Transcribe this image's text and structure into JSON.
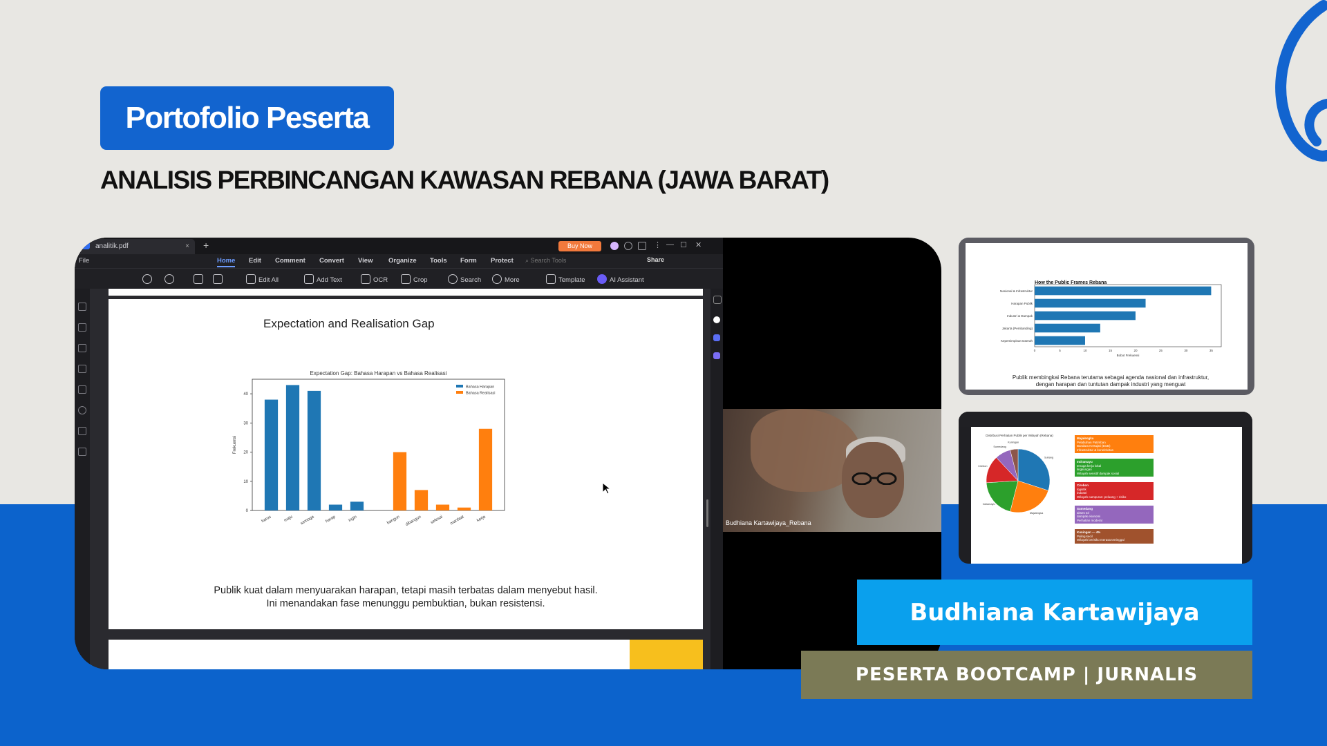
{
  "header": {
    "badge": "Portofolio Peserta",
    "subtitle": "ANALISIS PERBINCANGAN KAWASAN REBANA (JAWA BARAT)"
  },
  "app": {
    "tab_label": "analitik.pdf",
    "buy_now": "Buy Now",
    "menu": {
      "file": "File",
      "items": [
        "Home",
        "Edit",
        "Comment",
        "Convert",
        "View",
        "Organize",
        "Tools",
        "Form",
        "Protect"
      ],
      "active": "Home",
      "search_placeholder": "Search Tools",
      "share": "Share"
    },
    "toolbar": {
      "edit_all": "Edit All",
      "add_text": "Add Text",
      "ocr": "OCR",
      "crop": "Crop",
      "search": "Search",
      "more": "More",
      "template": "Template",
      "ai_assistant": "AI Assistant"
    },
    "page": {
      "title": "Expectation and Realisation Gap",
      "caption": "Publik kuat dalam menyuarakan harapan, tetapi masih terbatas dalam menyebut hasil. Ini menandakan fase menunggu pembuktian, bukan resistensi."
    }
  },
  "webcam": {
    "name": "Budhiana Kartawijaya_Rebana"
  },
  "chart_data": [
    {
      "type": "bar",
      "title": "Expectation Gap: Bahasa Harapan vs Bahasa Realisasi",
      "xlabel": "",
      "ylabel": "Frekuensi",
      "ylim": [
        0,
        45
      ],
      "yticks": [
        0,
        10,
        20,
        30,
        40
      ],
      "legend": "top-right",
      "categories": [
        "harus",
        "maju",
        "semoga",
        "harap",
        "ingin",
        "",
        "bangun",
        "dibangun",
        "selesai",
        "manfaat",
        "kerja"
      ],
      "series": [
        {
          "name": "Bahasa Harapan",
          "color": "#1f77b4",
          "values": [
            38,
            43,
            41,
            2,
            3,
            null,
            null,
            null,
            null,
            null,
            null
          ]
        },
        {
          "name": "Bahasa Realisasi",
          "color": "#ff7f0e",
          "values": [
            null,
            null,
            null,
            null,
            null,
            null,
            20,
            7,
            2,
            1,
            28
          ]
        }
      ]
    },
    {
      "type": "bar",
      "orientation": "horizontal",
      "title": "How the Public Frames Rebana",
      "xlabel": "Bobot Frekuensi",
      "ylabel": "",
      "xlim": [
        0,
        37
      ],
      "xticks": [
        0,
        5,
        10,
        15,
        20,
        25,
        30,
        35
      ],
      "color": "#1f77b4",
      "categories": [
        "Nasional & Infrastruktur",
        "Harapan Publik",
        "Industri & Dampak",
        "Jakarta (Pembanding)",
        "Kepemimpinan Daerah"
      ],
      "values": [
        35,
        22,
        20,
        13,
        10
      ],
      "caption": "Publik membingkai Rebana terutama sebagai agenda nasional dan infrastruktur, dengan harapan dan tuntutan dampak industri yang menguat"
    },
    {
      "type": "pie",
      "title": "Distribusi Perhatian Publik per Wilayah (Rebana)",
      "categories": [
        "Subang",
        "Majalengka",
        "Indramayu",
        "Cirebon",
        "Sumedang",
        "Kuningan"
      ],
      "values": [
        30,
        24,
        20,
        14,
        8,
        4
      ],
      "colors": [
        "#1f77b4",
        "#ff7f0e",
        "#2ca02c",
        "#d62728",
        "#9467bd",
        "#8c564b"
      ]
    }
  ],
  "thumb2_legend": [
    {
      "title": "Majalengka",
      "lines": [
        "Pelabuhan Patimban",
        "Bandara Kertajati (BIJB)",
        "Infrastruktur & konektivitas"
      ],
      "color": "#ff7f0e"
    },
    {
      "title": "Indramayu",
      "lines": [
        "tenaga kerja lokal",
        "lingkungan",
        "Wilayah sensitif dampak sosial"
      ],
      "color": "#2ca02c"
    },
    {
      "title": "Cirebon",
      "lines": [
        "logistik",
        "industri",
        "Wilayah campuran: peluang + risiko"
      ],
      "color": "#d62728"
    },
    {
      "title": "Sumedang",
      "lines": [
        "akses tol",
        "dampak ekonomi",
        "Perhatian moderat"
      ],
      "color": "#9467bd"
    },
    {
      "title": "Kuningan — 4%",
      "lines": [
        "Paling kecil",
        "Wilayah berisiko merasa tertinggal"
      ],
      "color": "#a0522d"
    }
  ],
  "footer": {
    "name": "Budhiana Kartawijaya",
    "role": "PESERTA BOOTCAMP | JURNALIS"
  },
  "colors": {
    "brand_blue": "#0c63cc",
    "badge_blue": "#1264cf",
    "name_plate": "#0aa0ed",
    "role_plate": "#7b7a56"
  }
}
